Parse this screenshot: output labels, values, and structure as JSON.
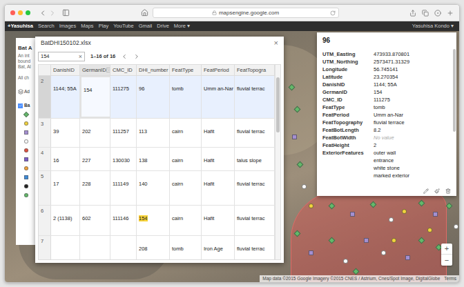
{
  "browser": {
    "url": "mapsengine.google.com"
  },
  "google_bar": {
    "links": [
      "+Yasuhisa",
      "Search",
      "Images",
      "Maps",
      "Play",
      "YouTube",
      "Gmail",
      "Drive",
      "More"
    ],
    "more_caret": "▾",
    "user": "Yasuhisa Kondo",
    "user_caret": "▾"
  },
  "layer_panel": {
    "title": "Bat A",
    "description": [
      "An int",
      "bound",
      "Bat, Al",
      "All ch"
    ],
    "add_button": "Ad",
    "layer": {
      "label": "Ba",
      "checked": true
    },
    "legend": [
      {
        "color": "#63b96a",
        "kind": "diamond"
      },
      {
        "color": "#f2d33d",
        "kind": "circle"
      },
      {
        "color": "#a48fd0",
        "kind": "square"
      },
      {
        "color": "#ffffff",
        "kind": "circle"
      },
      {
        "color": "#e25141",
        "kind": "circle"
      },
      {
        "color": "#7b5ec8",
        "kind": "square"
      },
      {
        "color": "#f2a33d",
        "kind": "circle"
      },
      {
        "color": "#3f8ad6",
        "kind": "square"
      },
      {
        "color": "#222222",
        "kind": "circle"
      },
      {
        "color": "#63b96a",
        "kind": "circle"
      }
    ]
  },
  "spreadsheet": {
    "title": "BatDHI150102.xlsx",
    "close": "×",
    "search": {
      "value": "154",
      "clear": "×"
    },
    "count": "1–16 of 16",
    "columns": [
      {
        "label": "DanishID",
        "hovered": false
      },
      {
        "label": "GermanID",
        "hovered": true
      },
      {
        "label": "CMC_ID",
        "hovered": false
      },
      {
        "label": "DHI_number",
        "hovered": false
      },
      {
        "label": "FeatType",
        "hovered": false
      },
      {
        "label": "FeatPeriod",
        "hovered": false
      },
      {
        "label": "FeatTopogra",
        "hovered": false
      }
    ],
    "rows": [
      {
        "num": "2",
        "selected": true,
        "cells": [
          {
            "text": "1144; 55A",
            "match": false,
            "active": false
          },
          {
            "text": "154",
            "match": false,
            "active": true
          },
          {
            "text": "111275",
            "match": false,
            "active": false
          },
          {
            "text": "96",
            "match": false,
            "active": false
          },
          {
            "text": "tomb",
            "match": false,
            "active": false
          },
          {
            "text": "Umm an-Nar",
            "match": false,
            "active": false
          },
          {
            "text": "fluvial terrac",
            "match": false,
            "active": false
          }
        ]
      },
      {
        "num": "3",
        "selected": false,
        "cells": [
          {
            "text": "39",
            "match": false,
            "active": false
          },
          {
            "text": "202",
            "match": false,
            "active": false
          },
          {
            "text": "111257",
            "match": false,
            "active": false
          },
          {
            "text": "113",
            "match": false,
            "active": false
          },
          {
            "text": "cairn",
            "match": false,
            "active": false
          },
          {
            "text": "Hafit",
            "match": false,
            "active": false
          },
          {
            "text": "fluvial terrac",
            "match": false,
            "active": false
          }
        ]
      },
      {
        "num": "4",
        "selected": false,
        "cells": [
          {
            "text": "16",
            "match": false,
            "active": false
          },
          {
            "text": "227",
            "match": false,
            "active": false
          },
          {
            "text": "130030",
            "match": false,
            "active": false
          },
          {
            "text": "138",
            "match": false,
            "active": false
          },
          {
            "text": "cairn",
            "match": false,
            "active": false
          },
          {
            "text": "Hafit",
            "match": false,
            "active": false
          },
          {
            "text": "talus slope",
            "match": false,
            "active": false
          }
        ]
      },
      {
        "num": "5",
        "selected": false,
        "cells": [
          {
            "text": "17",
            "match": false,
            "active": false
          },
          {
            "text": "228",
            "match": false,
            "active": false
          },
          {
            "text": "111149",
            "match": false,
            "active": false
          },
          {
            "text": "140",
            "match": false,
            "active": false
          },
          {
            "text": "cairn",
            "match": false,
            "active": false
          },
          {
            "text": "Hafit",
            "match": false,
            "active": false
          },
          {
            "text": "fluvial terrac",
            "match": false,
            "active": false
          }
        ]
      },
      {
        "num": "6",
        "selected": false,
        "cells": [
          {
            "text": "2 (1138)",
            "match": false,
            "active": false
          },
          {
            "text": "602",
            "match": false,
            "active": false
          },
          {
            "text": "111146",
            "match": false,
            "active": false
          },
          {
            "text": "154",
            "match": true,
            "active": false
          },
          {
            "text": "cairn",
            "match": false,
            "active": false
          },
          {
            "text": "Hafit",
            "match": false,
            "active": false
          },
          {
            "text": "fluvial terrac",
            "match": false,
            "active": false
          }
        ]
      },
      {
        "num": "7",
        "selected": false,
        "cells": [
          {
            "text": "",
            "match": false,
            "active": false
          },
          {
            "text": "",
            "match": false,
            "active": false
          },
          {
            "text": "",
            "match": false,
            "active": false
          },
          {
            "text": "208",
            "match": false,
            "active": false
          },
          {
            "text": "tomb",
            "match": false,
            "active": false
          },
          {
            "text": "Iron Age",
            "match": false,
            "active": false
          },
          {
            "text": "fluvial terrac",
            "match": false,
            "active": false
          }
        ]
      }
    ]
  },
  "details": {
    "title": "96",
    "fields": [
      {
        "label": "UTM_Easting",
        "values": [
          "473933.870801"
        ],
        "empty": false
      },
      {
        "label": "UTM_Northing",
        "values": [
          "2573471.31329"
        ],
        "empty": false
      },
      {
        "label": "Longitude",
        "values": [
          "56.745141"
        ],
        "empty": false
      },
      {
        "label": "Latitude",
        "values": [
          "23.270354"
        ],
        "empty": false
      },
      {
        "label": "DanishID",
        "values": [
          "1144; 55A"
        ],
        "empty": false
      },
      {
        "label": "GermanID",
        "values": [
          "154"
        ],
        "empty": false
      },
      {
        "label": "CMC_ID",
        "values": [
          "111275"
        ],
        "empty": false
      },
      {
        "label": "FeatType",
        "values": [
          "tomb"
        ],
        "empty": false
      },
      {
        "label": "FeatPeriod",
        "values": [
          "Umm an-Nar"
        ],
        "empty": false
      },
      {
        "label": "FeatTopography",
        "values": [
          "fluvial terrace"
        ],
        "empty": false
      },
      {
        "label": "FeatBotLength",
        "values": [
          "8.2"
        ],
        "empty": false
      },
      {
        "label": "FeatBotWidth",
        "values": [
          "No value"
        ],
        "empty": true
      },
      {
        "label": "FeatHeight",
        "values": [
          "2"
        ],
        "empty": false
      },
      {
        "label": "ExteriorFeatures",
        "values": [
          "outer wall",
          "entrance",
          "white stone",
          "marked exterior"
        ],
        "empty": false
      }
    ]
  },
  "map": {
    "attribution": "Map data ©2015 Google Imagery ©2015 CNES / Astrium, Cnes/Spot Image, DigitalGlobe",
    "terms": "Terms",
    "zoom_in": "+",
    "zoom_out": "−"
  }
}
